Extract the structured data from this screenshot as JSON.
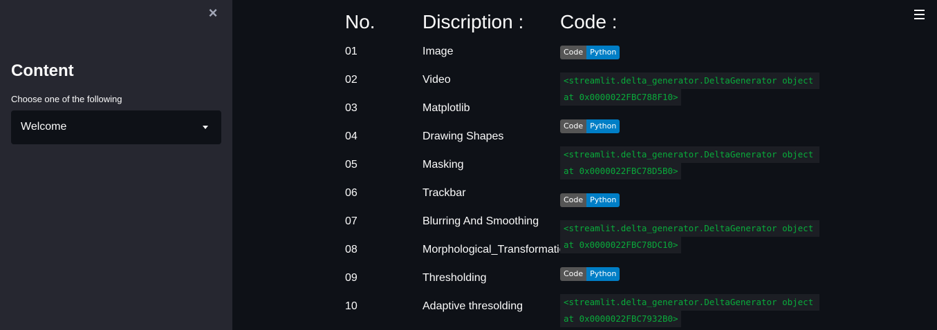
{
  "sidebar": {
    "close_label": "×",
    "title": "Content",
    "select_label": "Choose one of the following",
    "select_value": "Welcome"
  },
  "table": {
    "headers": {
      "no": "No.",
      "description": "Discription :",
      "code": "Code :"
    },
    "rows": [
      {
        "no": "01",
        "description": "Image"
      },
      {
        "no": "02",
        "description": "Video"
      },
      {
        "no": "03",
        "description": "Matplotlib"
      },
      {
        "no": "04",
        "description": "Drawing Shapes"
      },
      {
        "no": "05",
        "description": "Masking"
      },
      {
        "no": "06",
        "description": "Trackbar"
      },
      {
        "no": "07",
        "description": "Blurring And Smoothing"
      },
      {
        "no": "08",
        "description": "Morphological_Transformations"
      },
      {
        "no": "09",
        "description": "Thresholding"
      },
      {
        "no": "10",
        "description": "Adaptive thresolding"
      }
    ]
  },
  "badge": {
    "left": "Code",
    "right": "Python"
  },
  "code_blocks": [
    {
      "line1": "<streamlit.delta_generator.DeltaGenerator object",
      "line2": "at 0x0000022FBC788F10>"
    },
    {
      "line1": "<streamlit.delta_generator.DeltaGenerator object",
      "line2": "at 0x0000022FBC78D5B0>"
    },
    {
      "line1": "<streamlit.delta_generator.DeltaGenerator object",
      "line2": "at 0x0000022FBC78DC10>"
    },
    {
      "line1": "<streamlit.delta_generator.DeltaGenerator object",
      "line2": "at 0x0000022FBC7932B0>"
    }
  ],
  "colors": {
    "main_bg": "#0e1117",
    "sidebar_bg": "#262730",
    "code_green": "#09ab3b",
    "badge_blue": "#007ec6",
    "badge_gray": "#555555"
  },
  "icons": [
    "close-icon",
    "chevron-down-icon",
    "hamburger-menu-icon"
  ]
}
